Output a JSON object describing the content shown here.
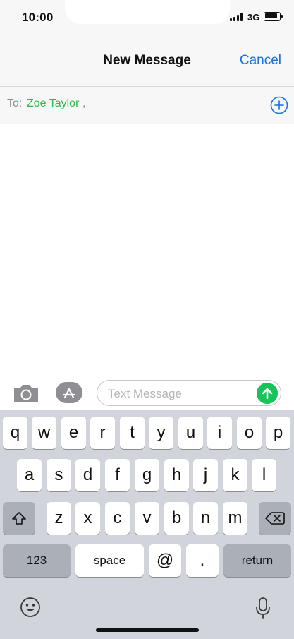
{
  "status": {
    "time": "10:00",
    "network": "3G"
  },
  "nav": {
    "title": "New Message",
    "cancel": "Cancel"
  },
  "to": {
    "label": "To:",
    "recipient": "Zoe Taylor",
    "separator": ","
  },
  "compose": {
    "placeholder": "Text Message"
  },
  "keyboard": {
    "row1": [
      "q",
      "w",
      "e",
      "r",
      "t",
      "y",
      "u",
      "i",
      "o",
      "p"
    ],
    "row2": [
      "a",
      "s",
      "d",
      "f",
      "g",
      "h",
      "j",
      "k",
      "l"
    ],
    "row3": [
      "z",
      "x",
      "c",
      "v",
      "b",
      "n",
      "m"
    ],
    "bottom": {
      "numbers": "123",
      "space": "space",
      "at": "@",
      "dot": ".",
      "return": "return"
    }
  },
  "icons": {
    "shift": "shift-icon",
    "delete": "backspace-icon",
    "emoji": "emoji-icon",
    "mic": "microphone-icon",
    "camera": "camera-icon",
    "appstore": "app-store-icon",
    "add": "add-contact-icon",
    "send": "send-arrow-icon"
  },
  "colors": {
    "accent": "#1a6fe3",
    "recipient": "#2db84a",
    "send": "#16c45a"
  }
}
